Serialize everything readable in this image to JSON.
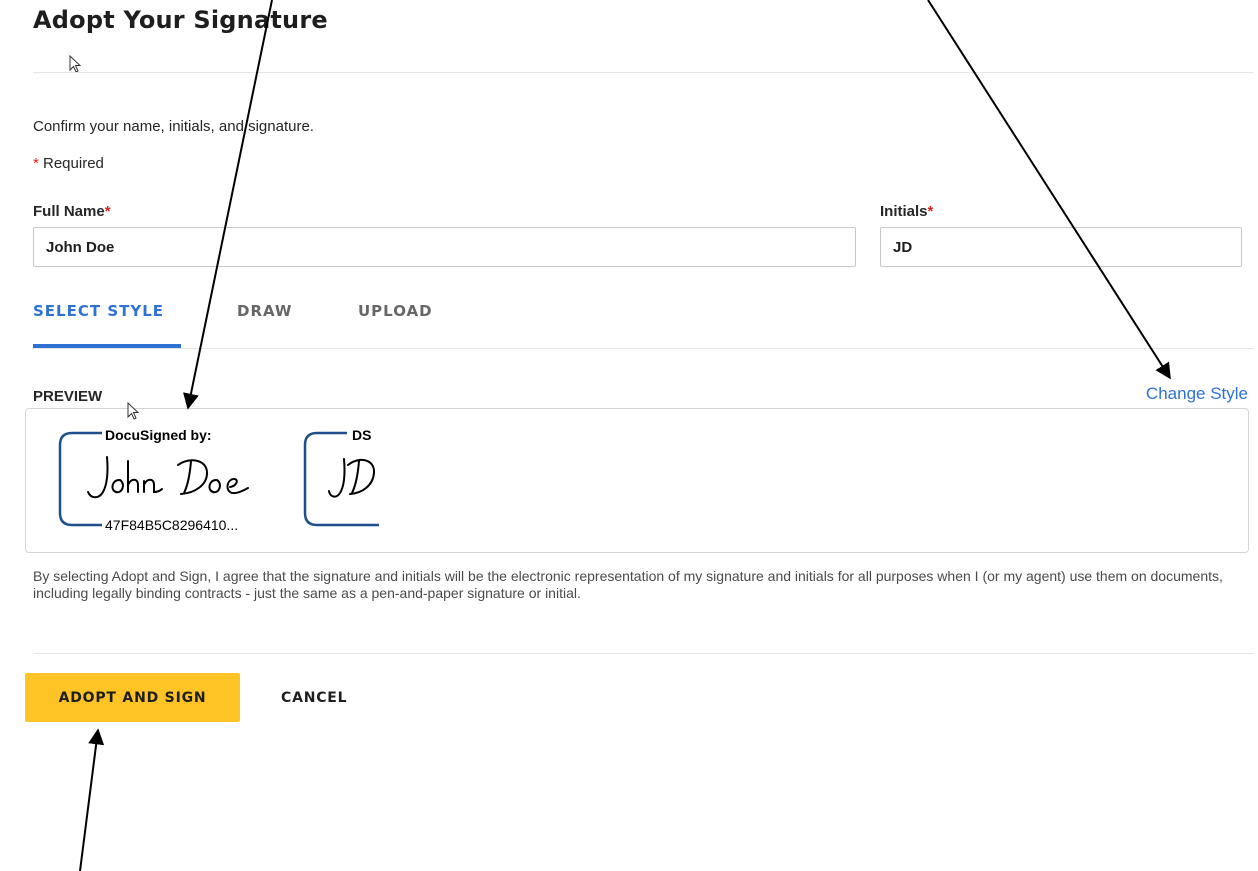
{
  "dialog": {
    "title": "Adopt Your Signature",
    "intro": "Confirm your name, initials, and signature.",
    "required_star": "*",
    "required_text": " Required"
  },
  "form": {
    "full_name_label": "Full Name",
    "full_name_value": "John Doe",
    "initials_label": "Initials",
    "initials_value": "JD",
    "required_marker": "*"
  },
  "tabs": [
    {
      "label": "SELECT STYLE",
      "active": true
    },
    {
      "label": "DRAW",
      "active": false
    },
    {
      "label": "UPLOAD",
      "active": false
    }
  ],
  "preview": {
    "label": "PREVIEW",
    "change_style": "Change Style",
    "signature": {
      "header": "DocuSigned by:",
      "handwritten": "John Doe",
      "envelope_id": "47F84B5C8296410..."
    },
    "initials": {
      "header": "DS",
      "handwritten": "JD"
    },
    "frame_color": "#1f4e8c"
  },
  "legal_text": "By selecting Adopt and Sign, I agree that the signature and initials will be the electronic representation of my signature and initials for all purposes when I (or my agent) use them on documents, including legally binding contracts - just the same as a pen-and-paper signature or initial.",
  "actions": {
    "adopt_label": "ADOPT AND SIGN",
    "cancel_label": "CANCEL"
  },
  "colors": {
    "accent": "#2f72d4",
    "primary_button": "#fec324",
    "required": "#e21d1d"
  }
}
